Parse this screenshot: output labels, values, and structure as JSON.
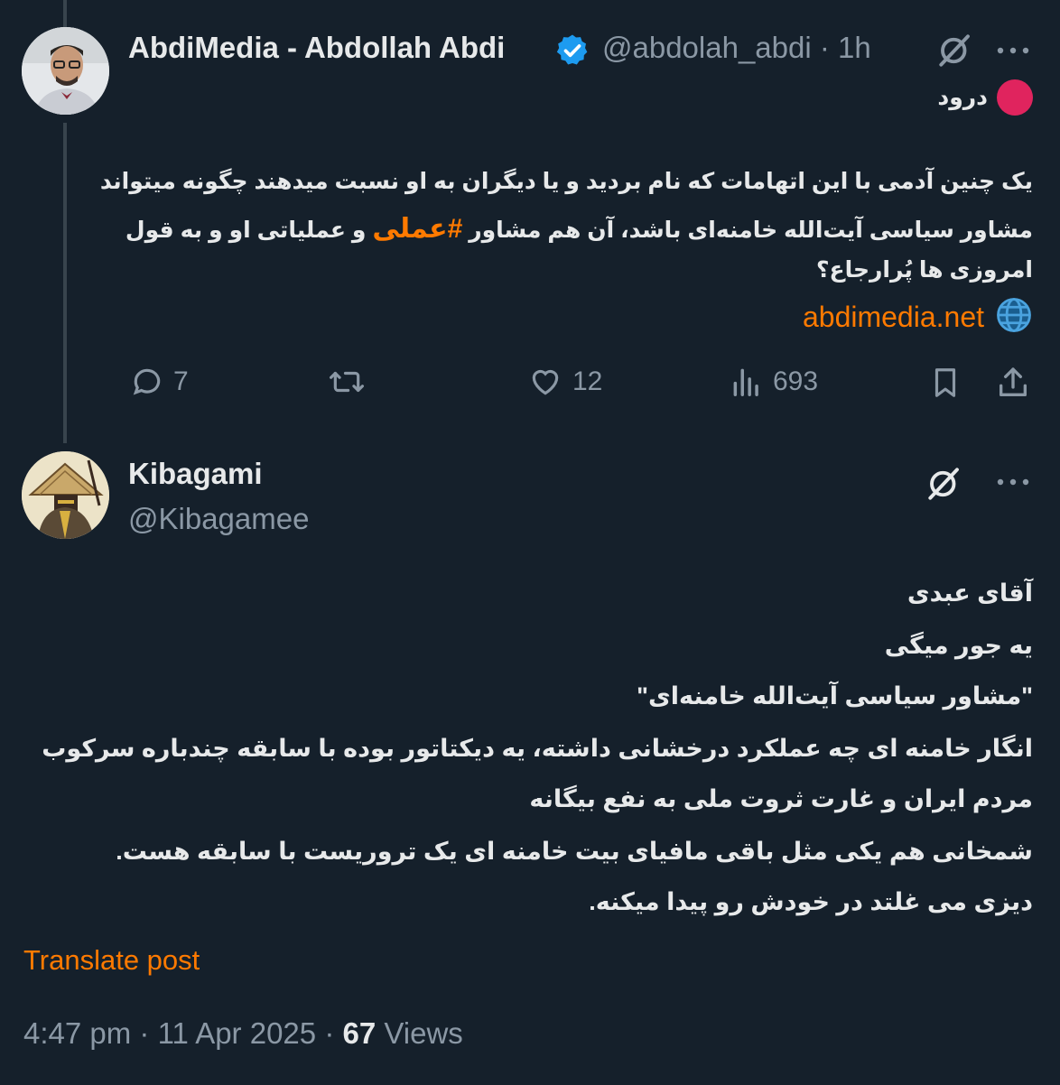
{
  "tweet1": {
    "display_name": "AbdiMedia - Abdollah Abdi",
    "handle": "@abdolah_abdi",
    "separator": "·",
    "time": "1h",
    "location_line": "درود",
    "body_lines": [
      "یک چنین آدمی با این اتهامات که نام بردید و یا دیگران به او نسبت میدهند چگونه میتواند",
      "امروزی ها پُرارجاع؟"
    ],
    "body_line2_part1": "مشاور سیاسی آیت‌الله خامنه‌ای باشد، آن هم مشاور ",
    "body_line2_hashtag": "#عملی",
    "body_line2_part2": " و عملیاتی او و به قول",
    "link": "abdimedia.net",
    "actions": {
      "replies": "7",
      "retweets": "",
      "likes": "12",
      "views": "693"
    },
    "colors": {
      "accent": "#ff7a00",
      "verified": "#1d9bf0",
      "flag_red": "#e0245e"
    }
  },
  "tweet2": {
    "display_name": "Kibagami",
    "handle": "@Kibagamee",
    "body_lines": [
      "آقای عبدی",
      "یه جور میگی",
      "\"مشاور سیاسی آیت‌الله خامنه‌ای\"",
      "انگار خامنه ای چه عملکرد درخشانی داشته، یه دیکتاتور بوده با سابقه چندباره سرکوب",
      "مردم ایران و غارت ثروت ملی به نفع بیگانه",
      "شمخانی هم یکی مثل باقی مافیای بیت خامنه ای یک تروریست با سابقه هست.",
      "دیزی می غلتد در خودش رو پیدا میکنه."
    ],
    "translate_label": "Translate post",
    "time": "4:47 pm",
    "date": "11 Apr 2025",
    "views_count": "67",
    "views_label": "Views",
    "meta_sep": "·"
  },
  "icons": [
    "grok-icon",
    "more-icon",
    "reply-icon",
    "retweet-icon",
    "like-icon",
    "views-icon",
    "bookmark-icon",
    "share-icon",
    "globe-icon",
    "verified-icon"
  ]
}
